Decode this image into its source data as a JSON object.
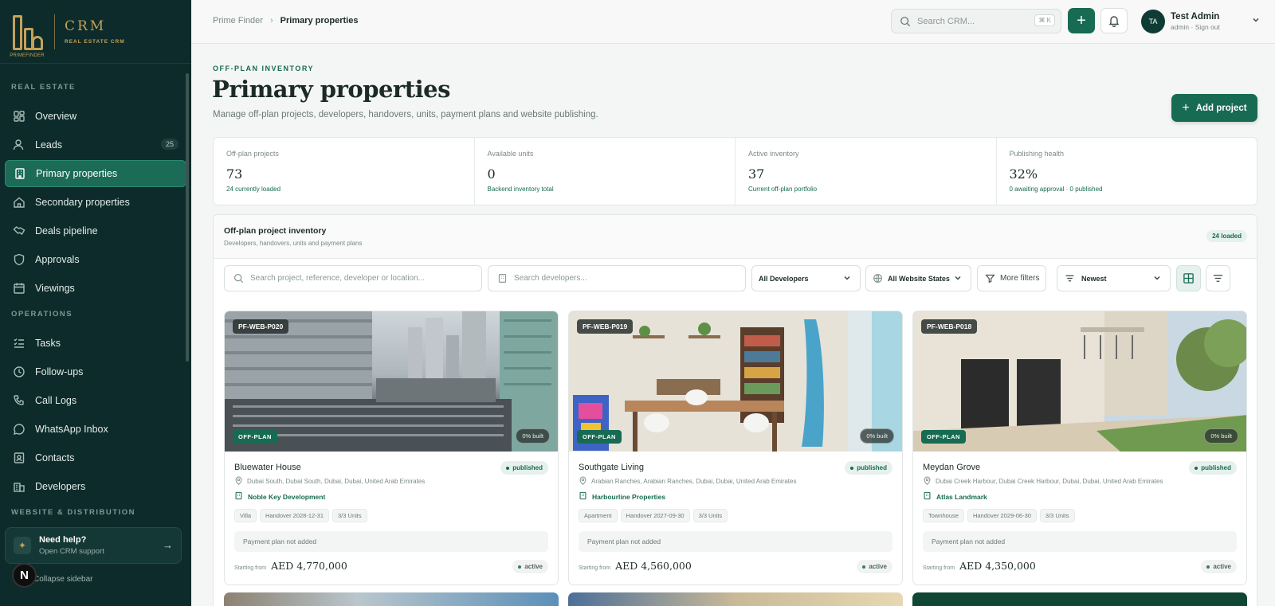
{
  "brand": {
    "name": "CRM",
    "tagline": "REAL ESTATE CRM",
    "logo_text": "PRIMEFINDER"
  },
  "sidebar": {
    "sections": [
      {
        "label": "REAL ESTATE"
      },
      {
        "label": "OPERATIONS"
      },
      {
        "label": "WEBSITE & DISTRIBUTION"
      }
    ],
    "items": [
      {
        "label": "Overview",
        "icon": "grid-icon"
      },
      {
        "label": "Leads",
        "icon": "users-icon",
        "badge": "25"
      },
      {
        "label": "Primary properties",
        "icon": "building-icon",
        "active": true
      },
      {
        "label": "Secondary properties",
        "icon": "home-icon"
      },
      {
        "label": "Deals pipeline",
        "icon": "handshake-icon"
      },
      {
        "label": "Approvals",
        "icon": "shield-icon"
      },
      {
        "label": "Viewings",
        "icon": "calendar-icon"
      },
      {
        "label": "Tasks",
        "icon": "list-checks-icon"
      },
      {
        "label": "Follow-ups",
        "icon": "clock-icon"
      },
      {
        "label": "Call Logs",
        "icon": "phone-icon"
      },
      {
        "label": "WhatsApp Inbox",
        "icon": "chat-icon"
      },
      {
        "label": "Contacts",
        "icon": "contact-card-icon"
      },
      {
        "label": "Developers",
        "icon": "office-icon"
      }
    ],
    "help": {
      "title": "Need help?",
      "subtitle": "Open CRM support"
    },
    "collapse_label": "Collapse sidebar",
    "avatar_letter": "N"
  },
  "topbar": {
    "breadcrumb": [
      "Prime Finder",
      "Primary properties"
    ],
    "search_placeholder": "Search CRM...",
    "search_shortcut": "⌘ K",
    "user": {
      "initials": "TA",
      "name": "Test Admin",
      "meta": "admin · Sign out"
    }
  },
  "page": {
    "eyebrow": "OFF-PLAN INVENTORY",
    "title": "Primary properties",
    "description": "Manage off-plan projects, developers, handovers, units, payment plans and website publishing.",
    "add_button": "Add project"
  },
  "stats": [
    {
      "label": "Off-plan projects",
      "value": "73",
      "hint": "24 currently loaded"
    },
    {
      "label": "Available units",
      "value": "0",
      "hint": "Backend inventory total"
    },
    {
      "label": "Active inventory",
      "value": "37",
      "hint": "Current off-plan portfolio"
    },
    {
      "label": "Publishing health",
      "value": "32%",
      "hint": "0 awaiting approval · 0 published"
    }
  ],
  "inventory": {
    "title": "Off-plan project inventory",
    "subtitle": "Developers, handovers, units and payment plans",
    "loaded_badge": "24 loaded",
    "filters": {
      "search_placeholder": "Search project, reference, developer or location...",
      "developer_search_placeholder": "Search developers...",
      "developers_select": "All Developers",
      "website_states_select": "All Website States",
      "more_filters": "More filters",
      "sort_select": "Newest"
    }
  },
  "cards": [
    {
      "ref": "PF-WEB-P020",
      "badge": "OFF-PLAN",
      "built": "0% built",
      "name": "Bluewater House",
      "status": "published",
      "location": "Dubai South, Dubai South, Dubai, Dubai, United Arab Emirates",
      "developer": "Noble Key Development",
      "tags": [
        "Villa",
        "Handover 2028-12-31",
        "3/3 Units"
      ],
      "payment_plan": "Payment plan not added",
      "starting_from": "Starting from",
      "price": "AED 4,770,000",
      "state": "active"
    },
    {
      "ref": "PF-WEB-P019",
      "badge": "OFF-PLAN",
      "built": "0% built",
      "name": "Southgate Living",
      "status": "published",
      "location": "Arabian Ranches, Arabian Ranches, Dubai, Dubai, United Arab Emirates",
      "developer": "Harbourline Properties",
      "tags": [
        "Apartment",
        "Handover 2027-09-30",
        "3/3 Units"
      ],
      "payment_plan": "Payment plan not added",
      "starting_from": "Starting from",
      "price": "AED 4,560,000",
      "state": "active"
    },
    {
      "ref": "PF-WEB-P018",
      "badge": "OFF-PLAN",
      "built": "0% built",
      "name": "Meydan Grove",
      "status": "published",
      "location": "Dubai Creek Harbour, Dubai Creek Harbour, Dubai, Dubai, United Arab Emirates",
      "developer": "Atlas Landmark",
      "tags": [
        "Townhouse",
        "Handover 2029-06-30",
        "3/3 Units"
      ],
      "payment_plan": "Payment plan not added",
      "starting_from": "Starting from",
      "price": "AED 4,350,000",
      "state": "active"
    }
  ],
  "colors": {
    "accent": "#176b52",
    "sidebar_bg": "#0c2b2a",
    "gold": "#c6a15a"
  }
}
